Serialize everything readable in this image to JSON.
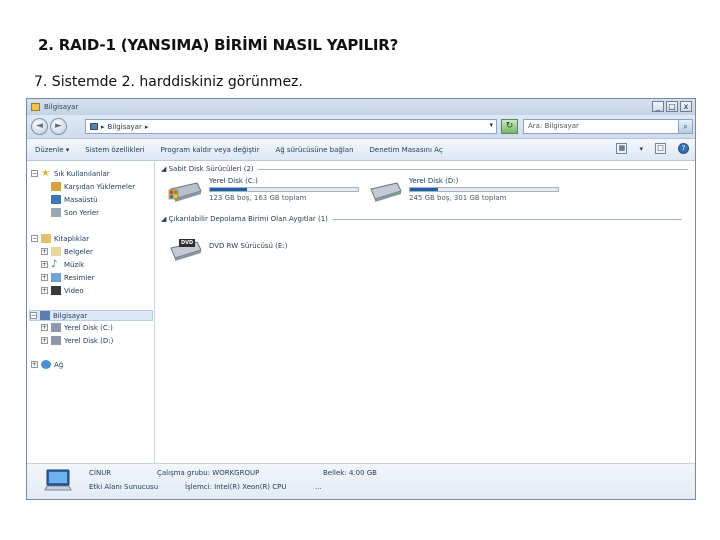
{
  "slide": {
    "title": "2. RAID-1 (YANSIMA) BİRİMİ NASIL YAPILIR?",
    "subtitle": "7. Sistemde 2. harddiskiniz görünmez."
  },
  "window": {
    "title": "Bilgisayar",
    "buttons": {
      "minimize": "_",
      "maximize": "□",
      "close": "x"
    }
  },
  "address": {
    "path_separator": "▸",
    "path": "Bilgisayar",
    "path_arrow": "▸",
    "dropdown": "▾",
    "back": "◄",
    "forward": "►",
    "refresh": "↻",
    "search_placeholder": "Ara: Bilgisayar",
    "search_icon": "⌕"
  },
  "toolbar": {
    "organize": "Düzenle ▾",
    "system_properties": "Sistem özellikleri",
    "uninstall": "Program kaldır veya değiştir",
    "map_drive": "Ağ sürücüsüne bağlan",
    "control_panel": "Denetim Masasını Aç",
    "view_icon": "▦",
    "view_arrow": "▾",
    "pane_icon": "□",
    "help_icon": "?"
  },
  "nav": {
    "favorites": "Sık Kullanılanlar",
    "downloads": "Karşıdan Yüklemeler",
    "desktop": "Masaüstü",
    "recent": "Son Yerler",
    "libraries": "Kitaplıklar",
    "documents": "Belgeler",
    "music": "Müzik",
    "pictures": "Resimler",
    "videos": "Video",
    "computer": "Bilgisayar",
    "drive_c": "Yerel Disk (C:)",
    "drive_d": "Yerel Disk (D:)",
    "network": "Ağ",
    "collapse": "−",
    "expand": "+"
  },
  "content": {
    "hdd_group": "◢ Sabit Disk Sürücüleri (2)",
    "removable_group": "◢ Çıkarılabilir Depolama Birimi Olan Aygıtlar (1)",
    "drives": [
      {
        "name": "Yerel Disk (C:)",
        "size": "123 GB boş, 163 GB toplam",
        "used_fraction": 0.25
      },
      {
        "name": "Yerel Disk (D:)",
        "size": "245 GB boş, 301 GB toplam",
        "used_fraction": 0.19
      }
    ],
    "dvd": {
      "name": "DVD RW Sürücüsü (E:)",
      "label": "DVD"
    }
  },
  "details": {
    "name": "CİNUR",
    "role": "Etki Alanı Sunucusu",
    "workgroup": "Çalışma grubu: WORKGROUP",
    "processor": "İşlemci: Intel(R) Xeon(R) CPU",
    "processor_more": "...",
    "memory": "Bellek: 4.00 GB"
  }
}
